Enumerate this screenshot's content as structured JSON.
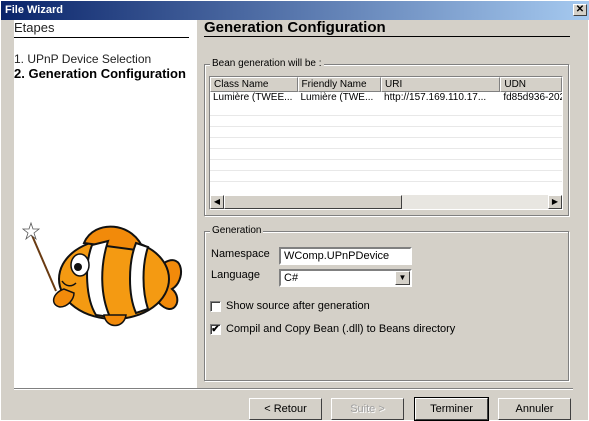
{
  "window": {
    "title": "File Wizard",
    "close_glyph": "✕"
  },
  "left": {
    "header": "Etapes",
    "steps": [
      "1. UPnP Device Selection",
      "2. Generation Configuration"
    ]
  },
  "main": {
    "title": "Generation Configuration",
    "bean_group_label": "Bean generation will be :",
    "table": {
      "columns": [
        "Class Name",
        "Friendly Name",
        "URI",
        "UDN"
      ],
      "rows": [
        [
          "Lumière (TWEE...",
          "Lumière (TWE...",
          "http://157.169.110.17...",
          "fd85d936-202"
        ]
      ]
    },
    "generation": {
      "group_label": "Generation",
      "namespace_label": "Namespace",
      "namespace_value": "WComp.UPnPDevice",
      "language_label": "Language",
      "language_value": "C#",
      "show_source_label": "Show source after generation",
      "show_source_checked": false,
      "compil_label": "Compil and Copy Bean (.dll) to Beans directory",
      "compil_checked": true,
      "check_glyph": "✔"
    }
  },
  "buttons": {
    "back": "< Retour",
    "next": "Suite >",
    "finish": "Terminer",
    "cancel": "Annuler"
  },
  "icons": {
    "scroll_left": "◀",
    "scroll_right": "▶",
    "dropdown": "▼"
  }
}
